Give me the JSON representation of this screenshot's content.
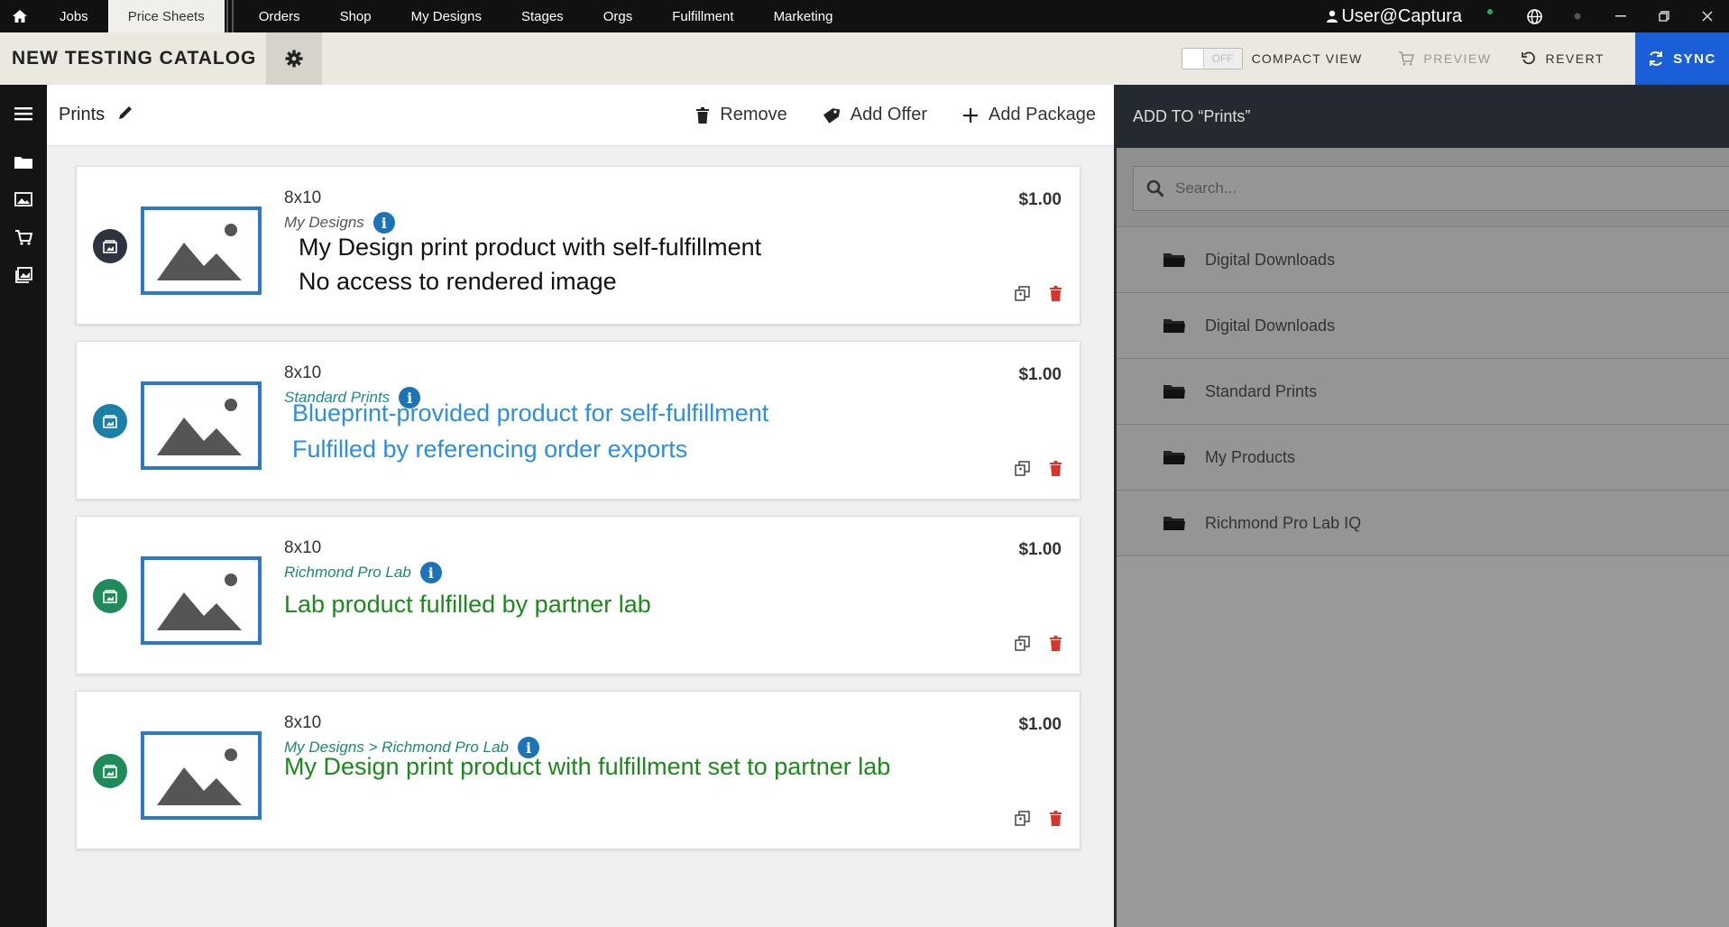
{
  "topnav": {
    "items": [
      {
        "label": "Jobs",
        "active": false
      },
      {
        "label": "Price Sheets",
        "active": true
      },
      {
        "label": "Orders",
        "active": false
      },
      {
        "label": "Shop",
        "active": false
      },
      {
        "label": "My Designs",
        "active": false
      },
      {
        "label": "Stages",
        "active": false
      },
      {
        "label": "Orgs",
        "active": false
      },
      {
        "label": "Fulfillment",
        "active": false
      },
      {
        "label": "Marketing",
        "active": false
      }
    ],
    "user": "User@Captura"
  },
  "header": {
    "catalog_title": "NEW TESTING CATALOG",
    "toggle_state": "OFF",
    "compact_view_label": "COMPACT VIEW",
    "preview_label": "PREVIEW",
    "revert_label": "REVERT",
    "sync_label": "SYNC"
  },
  "toolbar": {
    "title": "Prints",
    "remove_label": "Remove",
    "add_offer_label": "Add Offer",
    "add_package_label": "Add Package"
  },
  "products": [
    {
      "size": "8x10",
      "source": "My Designs",
      "source_color": "#555555",
      "badge_color": "#2d3440",
      "price": "$1.00",
      "note_lines": [
        "My Design print product with self-fulfillment",
        "No access to rendered image"
      ],
      "note_color": "#111111"
    },
    {
      "size": "8x10",
      "source": "Standard Prints",
      "source_color": "#1b8a9a",
      "badge_color": "#1b7fa8",
      "price": "$1.00",
      "note_lines": [
        "Blueprint-provided product for self-fulfillment",
        "Fulfilled by referencing order exports"
      ],
      "note_color": "#2a8fe0"
    },
    {
      "size": "8x10",
      "source": "Richmond Pro Lab",
      "source_color": "#1b8a6a",
      "badge_color": "#1f8a5a",
      "price": "$1.00",
      "note_lines": [
        "Lab product fulfilled by partner lab"
      ],
      "note_color": "#1a8a1a"
    },
    {
      "size": "8x10",
      "source": "My Designs > Richmond Pro Lab",
      "source_color": "#1b8a6a",
      "badge_color": "#1f8a5a",
      "price": "$1.00",
      "note_lines": [
        "My Design print product with fulfillment set to partner lab"
      ],
      "note_color": "#1a8a1a"
    }
  ],
  "panel": {
    "title": "ADD TO “Prints”",
    "search_placeholder": "Search...",
    "folders": [
      "Digital Downloads",
      "Digital Downloads",
      "Standard Prints",
      "My Products",
      "Richmond Pro Lab IQ"
    ]
  },
  "colors": {
    "accent": "#1a5fd8",
    "thumb_border": "#2c79c9",
    "delete": "#d9342b"
  }
}
